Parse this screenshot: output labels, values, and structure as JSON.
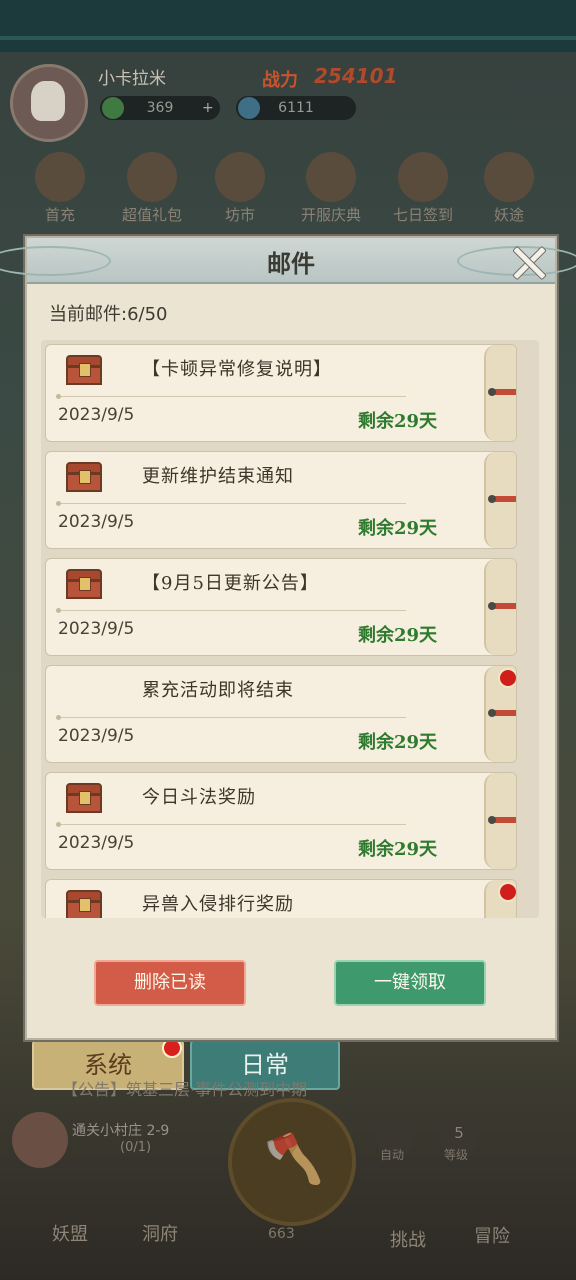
{
  "background": {
    "player_name": "小卡拉米",
    "power_label": "战力",
    "power_value": "254101",
    "jade": "369",
    "crystal": "6111",
    "features": [
      "首充",
      "超值礼包",
      "坊市",
      "开服庆典",
      "七日签到",
      "妖途"
    ],
    "tabs": {
      "system": "系统",
      "daily": "日常"
    },
    "notice": "【公告】筑基三层·事件公测到中期",
    "stage_title": "通关小村庄 2-9",
    "stage_progress": "(0/1)",
    "auto_label": "自动",
    "level_badge": "5",
    "level_label": "等级",
    "energy": "663",
    "bottom_nav": [
      "妖盟",
      "洞府",
      "挑战",
      "冒险"
    ]
  },
  "modal": {
    "title": "邮件",
    "count_text": "当前邮件:6/50",
    "mails": [
      {
        "subject": "【卡顿异常修复说明】",
        "date": "2023/9/5",
        "remain": "剩余29天",
        "has_chest": true,
        "unread_dot": false
      },
      {
        "subject": "更新维护结束通知",
        "date": "2023/9/5",
        "remain": "剩余29天",
        "has_chest": true,
        "unread_dot": false
      },
      {
        "subject": "【9月5日更新公告】",
        "date": "2023/9/5",
        "remain": "剩余29天",
        "has_chest": true,
        "unread_dot": false
      },
      {
        "subject": "累充活动即将结束",
        "date": "2023/9/5",
        "remain": "剩余29天",
        "has_chest": false,
        "unread_dot": true
      },
      {
        "subject": "今日斗法奖励",
        "date": "2023/9/5",
        "remain": "剩余29天",
        "has_chest": true,
        "unread_dot": false
      },
      {
        "subject": "异兽入侵排行奖励",
        "date": "",
        "remain": "",
        "has_chest": true,
        "unread_dot": true
      }
    ],
    "delete_read_label": "删除已读",
    "claim_all_label": "一键领取"
  },
  "colors": {
    "remain_green": "#2e7a2e",
    "delete_red": "#d25c47",
    "claim_green": "#3e9a6c"
  }
}
